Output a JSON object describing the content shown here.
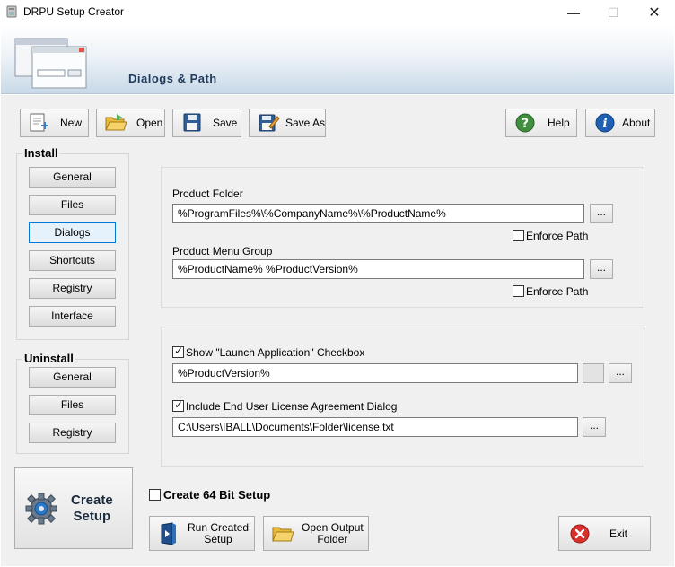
{
  "window": {
    "title": "DRPU Setup Creator"
  },
  "header": {
    "title": "Dialogs & Path"
  },
  "toolbar": {
    "new_label": "New",
    "open_label": "Open",
    "save_label": "Save",
    "save_as_label": "Save As",
    "help_label": "Help",
    "about_label": "About"
  },
  "install": {
    "title": "Install",
    "items": [
      "General",
      "Files",
      "Dialogs",
      "Shortcuts",
      "Registry",
      "Interface"
    ]
  },
  "uninstall": {
    "title": "Uninstall",
    "items": [
      "General",
      "Files",
      "Registry"
    ]
  },
  "create_setup": {
    "line1": "Create",
    "line2": "Setup"
  },
  "paths": {
    "product_folder_label": "Product Folder",
    "product_folder_value": "%ProgramFiles%\\%CompanyName%\\%ProductName%",
    "enforce_path_label": "Enforce Path",
    "menu_group_label": "Product Menu Group",
    "menu_group_value": "%ProductName% %ProductVersion%",
    "browse_label": "..."
  },
  "dialogs": {
    "launch_label": "Show \"Launch Application\" Checkbox",
    "launch_value": "%ProductVersion%",
    "eula_label": "Include End User License Agreement Dialog",
    "eula_value": "C:\\Users\\IBALL\\Documents\\Folder\\license.txt"
  },
  "bottom": {
    "create64_label": "Create 64 Bit Setup",
    "run_line1": "Run Created",
    "run_line2": "Setup",
    "open_line1": "Open Output",
    "open_line2": "Folder",
    "exit_label": "Exit"
  }
}
